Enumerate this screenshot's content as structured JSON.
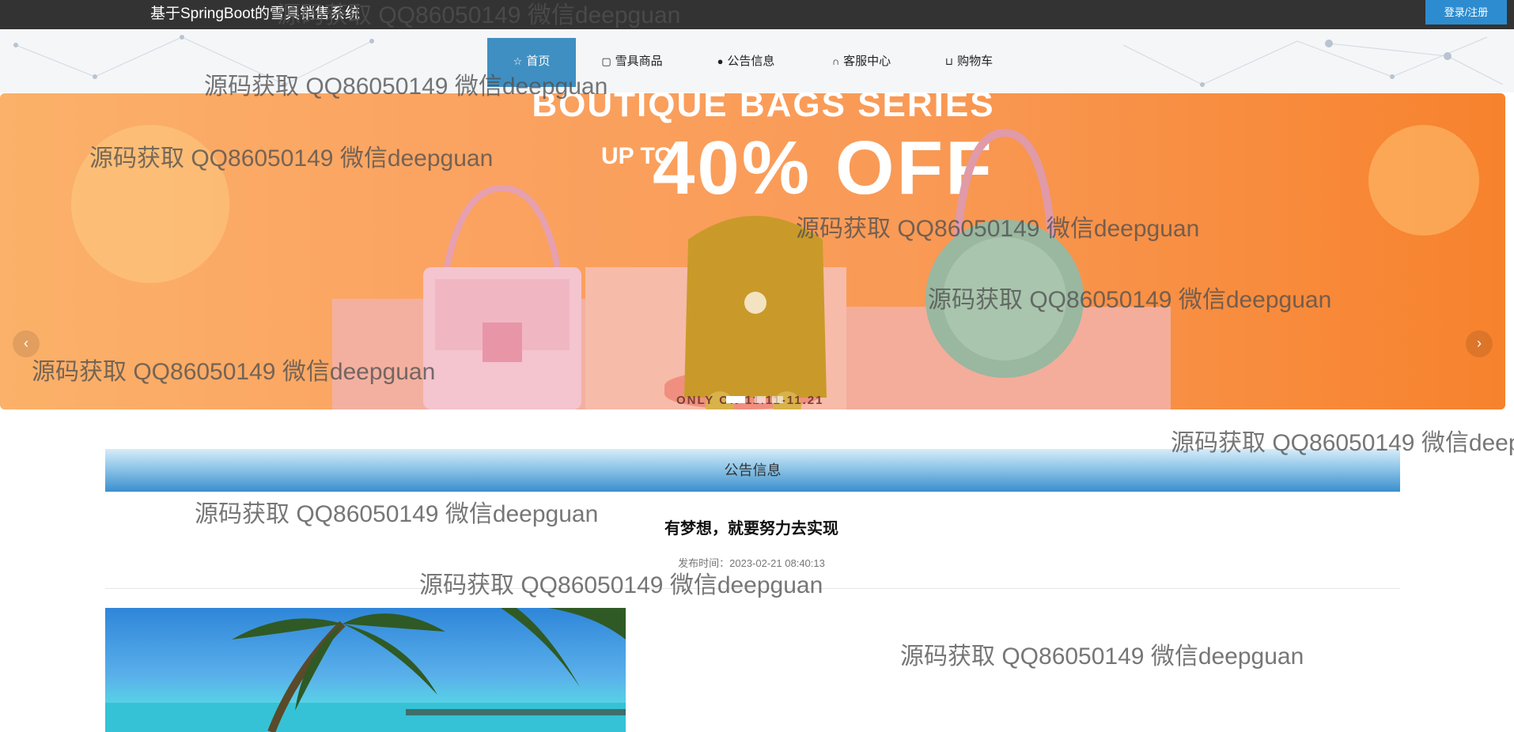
{
  "header": {
    "site_title": "基于SpringBoot的雪具销售系统",
    "login_label": "登录/注册"
  },
  "nav": {
    "items": [
      {
        "label": "首页",
        "icon": "star-icon",
        "active": true
      },
      {
        "label": "雪具商品",
        "icon": "bag-icon",
        "active": false
      },
      {
        "label": "公告信息",
        "icon": "info-icon",
        "active": false
      },
      {
        "label": "客服中心",
        "icon": "headset-icon",
        "active": false
      },
      {
        "label": "购物车",
        "icon": "cart-icon",
        "active": false
      }
    ]
  },
  "banner": {
    "headline": "BOUTIQUE BAGS SERIES",
    "upto": "UP TO",
    "discount": "40% OFF",
    "footer_text": "ONLY ON 11.11-11.21",
    "prev_label": "‹",
    "next_label": "›",
    "slide_count": 3,
    "active_slide": 0
  },
  "notice": {
    "section_title": "公告信息",
    "title": "有梦想，就要努力去实现",
    "time_label": "发布时间：",
    "time_value": "2023-02-21 08:40:13"
  },
  "watermark": "源码获取 QQ86050149 微信deepguan",
  "colors": {
    "topbar": "#333333",
    "accent_blue": "#2d8ccf",
    "nav_active": "#3f8fc2",
    "banner_orange": "#f7822d"
  }
}
